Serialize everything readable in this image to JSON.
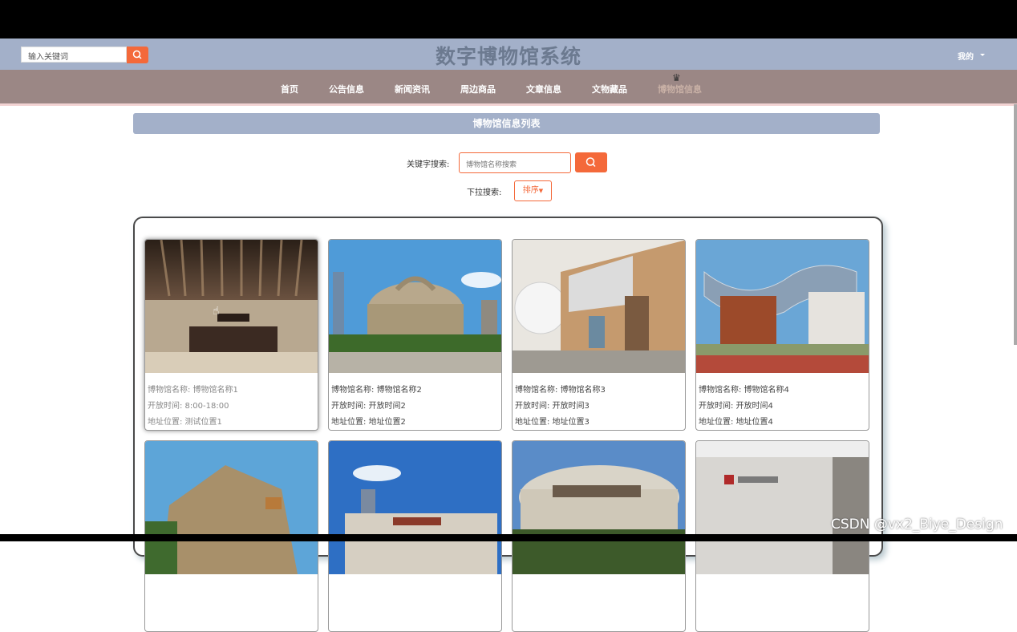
{
  "header": {
    "search_placeholder": "输入关键词",
    "title": "数字博物馆系统",
    "user_menu": "我的"
  },
  "nav": {
    "items": [
      "首页",
      "公告信息",
      "新闻资讯",
      "周边商品",
      "文章信息",
      "文物藏品",
      "博物馆信息"
    ],
    "active_index": 6
  },
  "section": {
    "title": "博物馆信息列表"
  },
  "filters": {
    "keyword_label": "关键字搜索:",
    "keyword_placeholder": "博物馆名称搜索",
    "dropdown_label": "下拉搜索:",
    "sort_label": "排序"
  },
  "museums": [
    {
      "name": "博物馆名称: 博物馆名称1",
      "hours": "开放时间: 8:00-18:00",
      "address": "地址位置: 测试位置1"
    },
    {
      "name": "博物馆名称: 博物馆名称2",
      "hours": "开放时间: 开放时间2",
      "address": "地址位置: 地址位置2"
    },
    {
      "name": "博物馆名称: 博物馆名称3",
      "hours": "开放时间: 开放时间3",
      "address": "地址位置: 地址位置3"
    },
    {
      "name": "博物馆名称: 博物馆名称4",
      "hours": "开放时间: 开放时间4",
      "address": "地址位置: 地址位置4"
    }
  ],
  "watermark": "CSDN @vx2_Biye_Design",
  "colors": {
    "accent": "#f4693a",
    "header_bg": "#a3b0c9",
    "nav_bg": "#9b8785"
  }
}
